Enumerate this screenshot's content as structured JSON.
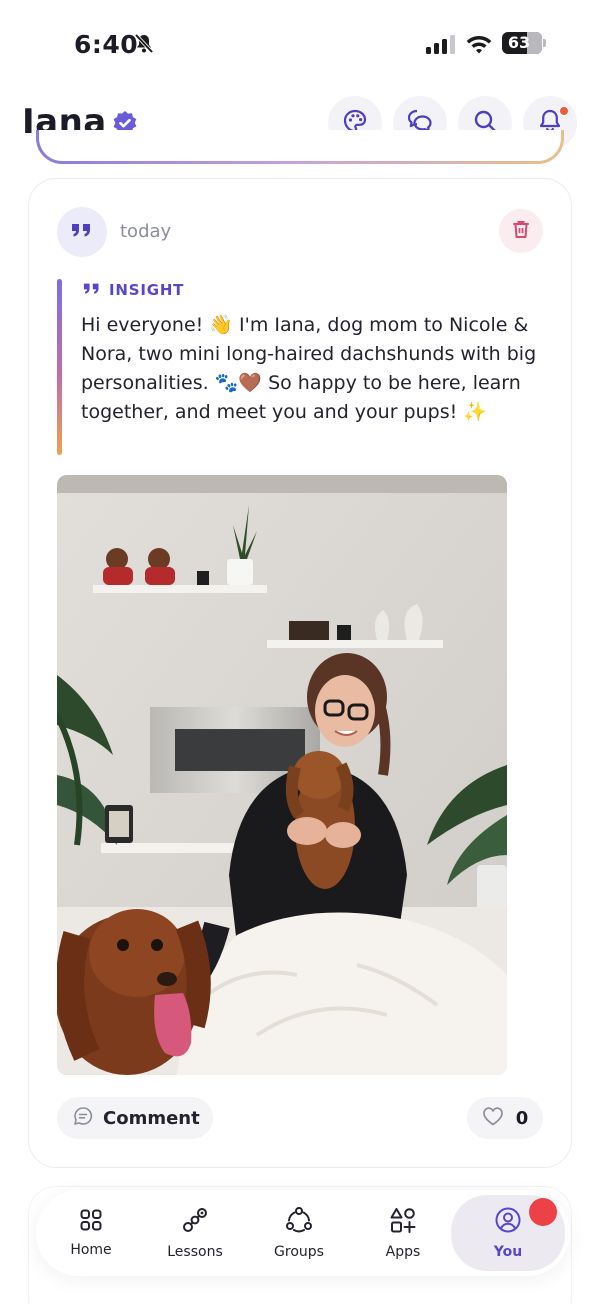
{
  "status_bar": {
    "time": "6:40",
    "battery": "63",
    "battery_level": 0.63
  },
  "header": {
    "profile_name": "Iana",
    "icons": [
      "verified-badge-icon",
      "palette-icon",
      "chat-icon",
      "search-icon",
      "bell-icon"
    ],
    "has_notification": true
  },
  "post": {
    "time": "today",
    "type_label": "INSIGHT",
    "text": "Hi everyone! 👋 I'm Iana, dog mom to Nicole & Nora, two mini long-haired dachshunds with big personalities. 🐾🤎 So happy to be here, learn together, and meet you and your pups! ✨",
    "comment_label": "Comment",
    "like_count": "0",
    "accent_gradient": [
      "#7b6fe0",
      "#c06ea6",
      "#eda24f"
    ]
  },
  "bottom_nav": {
    "items": [
      {
        "label": "Home",
        "icon": "home-grid-icon"
      },
      {
        "label": "Lessons",
        "icon": "lessons-path-icon"
      },
      {
        "label": "Groups",
        "icon": "groups-icon"
      },
      {
        "label": "Apps",
        "icon": "apps-icon"
      },
      {
        "label": "You",
        "icon": "profile-icon",
        "active": true
      }
    ]
  },
  "colors": {
    "accent": "#5847c8",
    "notification": "#ef5a3a",
    "badge": "#ec4146"
  }
}
